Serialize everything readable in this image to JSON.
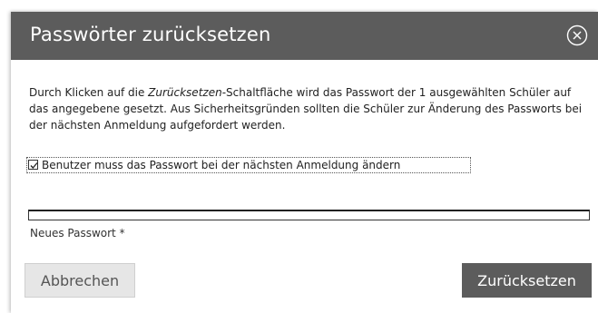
{
  "dialog": {
    "title": "Passwörter zurücksetzen",
    "close_icon": "close-circle-icon",
    "description": {
      "part1": "Durch Klicken auf die ",
      "emphasis": "Zurücksetzen",
      "part2": "-Schaltfläche wird das Passwort der 1 ausgewählten Schüler auf das angegebene gesetzt. Aus Sicherheitsgründen sollten die Schüler zur Änderung des Passworts bei der nächsten Anmeldung aufgefordert werden."
    },
    "checkbox": {
      "label": "Benutzer muss das Passwort bei der nächsten Anmeldung ändern",
      "checked": true
    },
    "password": {
      "value": "",
      "label": "Neues Passwort *"
    },
    "buttons": {
      "cancel": "Abbrechen",
      "reset": "Zurücksetzen"
    },
    "colors": {
      "header": "#5c5c5c",
      "primary_button": "#5c5c5c",
      "secondary_button": "#e6e6e6"
    }
  }
}
